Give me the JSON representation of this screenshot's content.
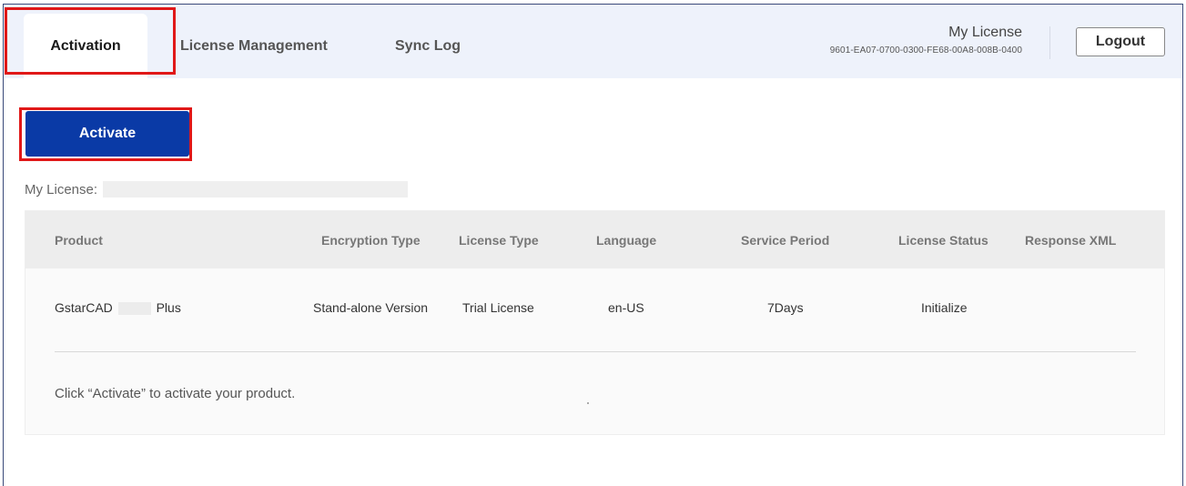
{
  "tabs": [
    {
      "label": "Activation",
      "active": true
    },
    {
      "label": "License Management",
      "active": false
    },
    {
      "label": "Sync Log",
      "active": false
    }
  ],
  "header": {
    "license_title": "My License",
    "license_key": "9601-EA07-0700-0300-FE68-00A8-008B-0400",
    "logout_label": "Logout"
  },
  "main": {
    "activate_label": "Activate",
    "my_license_label": "My License:",
    "hint": "Click “Activate” to activate your product."
  },
  "table": {
    "columns": [
      "Product",
      "Encryption Type",
      "License Type",
      "Language",
      "Service Period",
      "License Status",
      "Response XML"
    ],
    "rows": [
      {
        "product_prefix": "GstarCAD",
        "product_suffix": "Plus",
        "encryption_type": "Stand-alone Version",
        "license_type": "Trial License",
        "language": "en-US",
        "service_period": "7Days",
        "license_status": "Initialize",
        "response_xml": ""
      }
    ]
  },
  "colors": {
    "accent": "#0a3aa6",
    "highlight": "#e01818",
    "topbar": "#eef2fb"
  }
}
